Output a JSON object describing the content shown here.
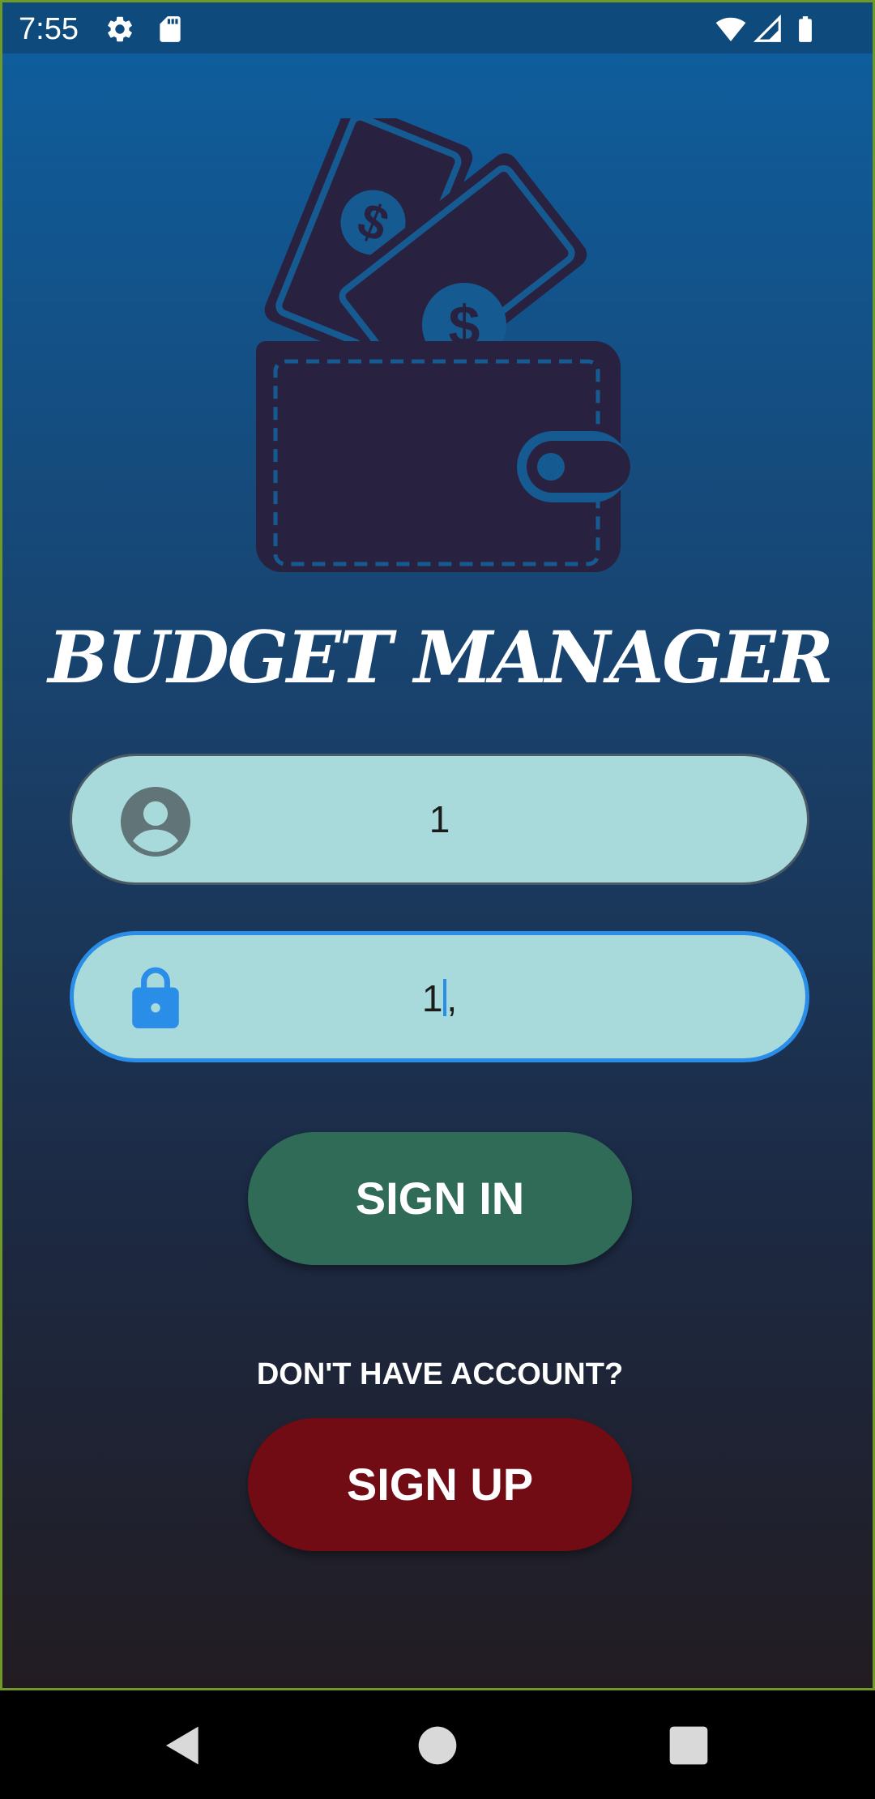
{
  "status_bar": {
    "time": "7:55",
    "icons": [
      "gear-icon",
      "sd-card-icon",
      "wifi-icon",
      "signal-icon",
      "battery-icon"
    ]
  },
  "app": {
    "title": "BUDGET MANAGER",
    "logo_icon": "wallet-with-cash-icon",
    "username_field": {
      "value": "1",
      "icon": "user-icon"
    },
    "password_field": {
      "value_before_caret": "1",
      "value_after_caret": ",",
      "icon": "lock-icon",
      "focused": true
    },
    "sign_in_label": "SIGN IN",
    "no_account_text": "DON'T HAVE ACCOUNT?",
    "sign_up_label": "SIGN UP"
  },
  "nav_bar": {
    "icons": [
      "back-icon",
      "home-icon",
      "recents-icon"
    ]
  },
  "colors": {
    "gradient_top": "#0f5d9c",
    "gradient_bottom": "#221c22",
    "field_bg": "#a8dadc",
    "focus_border": "#2a8de8",
    "sign_in_bg": "#2f6b56",
    "sign_up_bg": "#710b14",
    "logo_fill": "#282240"
  }
}
